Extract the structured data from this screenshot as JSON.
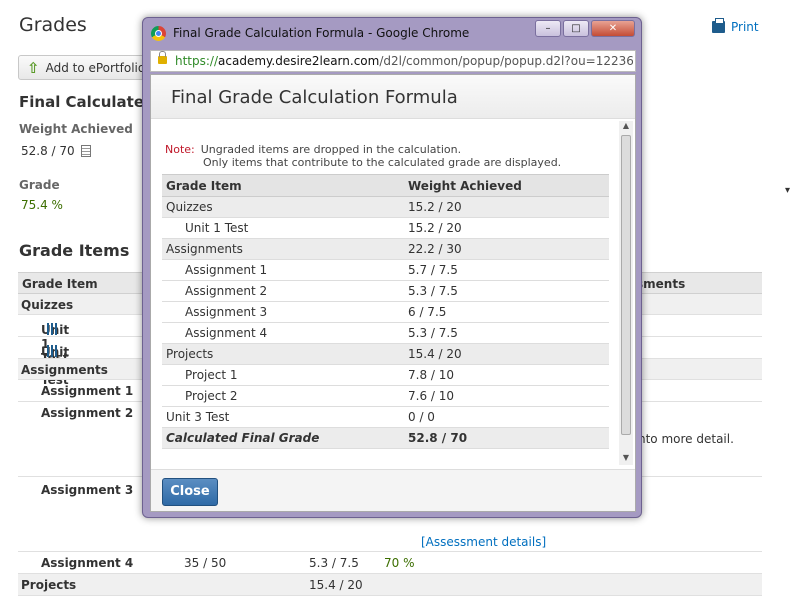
{
  "page": {
    "title": "Grades",
    "print_label": "Print",
    "eportfolio_label": "Add to ePortfolio",
    "final_section": "Final Calculated",
    "weight_label": "Weight Achieved",
    "weight_value": "52.8 / 70",
    "grade_label": "Grade",
    "grade_value": "75.4 %",
    "grade_items_heading": "Grade Items",
    "grid_headers": {
      "item": "Grade Item",
      "comments": "sments"
    },
    "rows": [
      {
        "name": "Quizzes",
        "type": "cat"
      },
      {
        "name": "Unit 1 Test",
        "type": "item"
      },
      {
        "name": "Unit 2 Test",
        "type": "item"
      },
      {
        "name": "Assignments",
        "type": "cat"
      },
      {
        "name": "Assignment 1",
        "type": "item"
      },
      {
        "name": "Assignment 2",
        "type": "item"
      },
      {
        "name": "Assignment 3",
        "type": "item"
      },
      {
        "name": "Assignment 4",
        "type": "item",
        "points": "35 / 50",
        "weight": "5.3 / 7.5",
        "grade": "70 %"
      },
      {
        "name": "Projects",
        "type": "cat",
        "weight": "15.4 / 20"
      }
    ],
    "detail_text": "nto more detail.",
    "assessment_link": "[Assessment details]",
    "partial_text": "..."
  },
  "window": {
    "title": "Final Grade Calculation Formula - Google Chrome",
    "url_https": "https://",
    "url_host": "academy.desire2learn.com",
    "url_rest": "/d2l/common/popup/popup.d2l?ou=12236&query$",
    "min_label": "–",
    "max_label": "□",
    "close_label": "✕"
  },
  "popup": {
    "title": "Final Grade Calculation Formula",
    "note_label": "Note:",
    "note_line1": "Ungraded items are dropped in the calculation.",
    "note_line2": "Only items that contribute to the calculated grade are displayed.",
    "col_item": "Grade Item",
    "col_weight": "Weight Achieved",
    "rows": [
      {
        "name": "Quizzes",
        "weight": "15.2 / 20",
        "type": "cat"
      },
      {
        "name": "Unit 1 Test",
        "weight": "15.2 / 20",
        "type": "item"
      },
      {
        "name": "Assignments",
        "weight": "22.2 / 30",
        "type": "cat"
      },
      {
        "name": "Assignment 1",
        "weight": "5.7 / 7.5",
        "type": "item"
      },
      {
        "name": "Assignment 2",
        "weight": "5.3 / 7.5",
        "type": "item"
      },
      {
        "name": "Assignment 3",
        "weight": "6 / 7.5",
        "type": "item"
      },
      {
        "name": "Assignment 4",
        "weight": "5.3 / 7.5",
        "type": "item"
      },
      {
        "name": "Projects",
        "weight": "15.4 / 20",
        "type": "cat"
      },
      {
        "name": "Project 1",
        "weight": "7.8 / 10",
        "type": "item"
      },
      {
        "name": "Project 2",
        "weight": "7.6 / 10",
        "type": "item"
      },
      {
        "name": "Unit 3 Test",
        "weight": "0 / 0",
        "type": "plain"
      }
    ],
    "final_name": "Calculated Final Grade",
    "final_weight": "52.8 / 70",
    "close_label": "Close"
  }
}
